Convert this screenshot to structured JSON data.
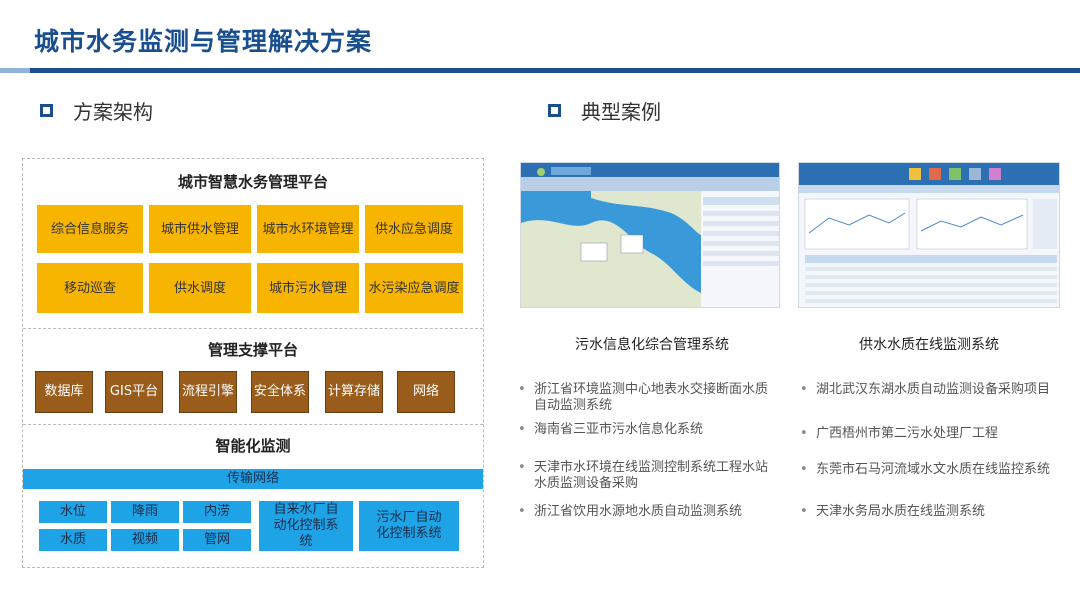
{
  "header": {
    "title": "城市水务监测与管理解决方案"
  },
  "sections": {
    "architecture": "方案架构",
    "cases": "典型案例"
  },
  "architecture": {
    "platform": {
      "title": "城市智慧水务管理平台",
      "items": [
        "综合信息服务",
        "城市供水管理",
        "城市水环境管理",
        "供水应急调度",
        "移动巡查",
        "供水调度",
        "城市污水管理",
        "水污染应急调度"
      ]
    },
    "support": {
      "title": "管理支撑平台",
      "items": [
        "数据库",
        "GIS平台",
        "流程引擎",
        "安全体系",
        "计算存储",
        "网络"
      ]
    },
    "monitor": {
      "title": "智能化监测",
      "network": "传输网络",
      "items": [
        "水位",
        "降雨",
        "内涝",
        "水质",
        "视频",
        "管网",
        "自来水厂自动化控制系统",
        "污水厂自动化控制系统"
      ]
    }
  },
  "cases": {
    "screenshots": [
      "污水信息化综合管理系统",
      "供水水质在线监测系统"
    ],
    "left_list": [
      "浙江省环境监测中心地表水交接断面水质自动监测系统",
      "海南省三亚市污水信息化系统",
      "天津市水环境在线监测控制系统工程水站水质监测设备采购",
      "浙江省饮用水源地水质自动监测系统"
    ],
    "right_list": [
      "湖北武汉东湖水质自动监测设备采购项目",
      "广西梧州市第二污水处理厂工程",
      "东莞市石马河流域水文水质在线监控系统",
      "天津水务局水质在线监测系统"
    ]
  },
  "colors": {
    "brand": "#1a4f8f",
    "platform": "#f7b500",
    "support": "#9a5c1a",
    "monitor": "#1da3e6"
  }
}
